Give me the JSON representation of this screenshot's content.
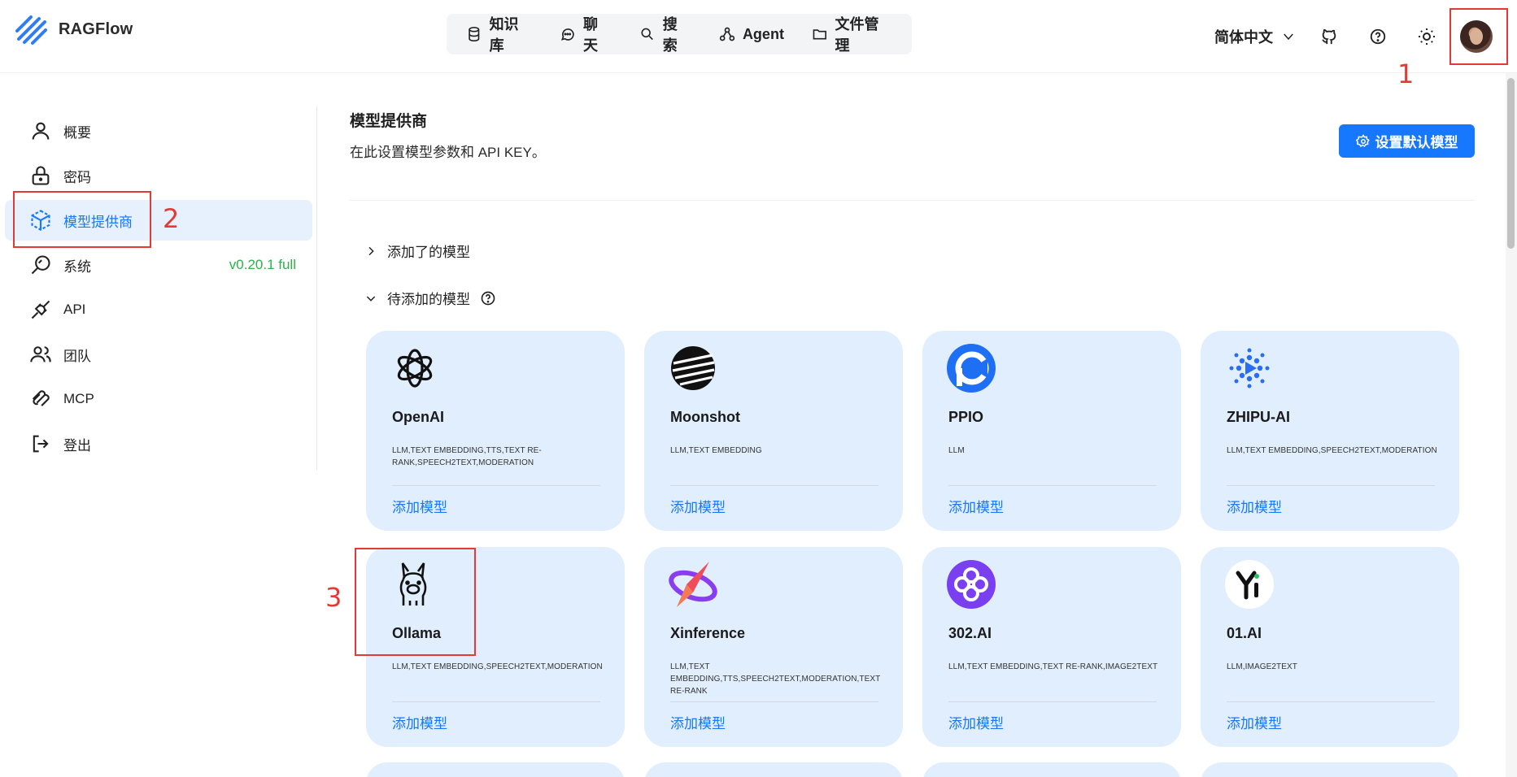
{
  "app": {
    "name": "RAGFlow"
  },
  "nav": [
    {
      "label": "知识库",
      "icon": "database-icon"
    },
    {
      "label": "聊天",
      "icon": "chat-icon"
    },
    {
      "label": "搜索",
      "icon": "search-icon"
    },
    {
      "label": "Agent",
      "icon": "agent-icon"
    },
    {
      "label": "文件管理",
      "icon": "folder-icon"
    }
  ],
  "header": {
    "language": "简体中文"
  },
  "sidebar": {
    "items": [
      {
        "label": "概要",
        "icon": "user-icon"
      },
      {
        "label": "密码",
        "icon": "lock-icon"
      },
      {
        "label": "模型提供商",
        "icon": "model-cube-icon",
        "active": true
      },
      {
        "label": "系统",
        "icon": "gauge-icon"
      },
      {
        "label": "API",
        "icon": "plug-icon"
      },
      {
        "label": "团队",
        "icon": "team-icon"
      },
      {
        "label": "MCP",
        "icon": "mcp-icon"
      },
      {
        "label": "登出",
        "icon": "logout-icon"
      }
    ],
    "version": "v0.20.1 full"
  },
  "main": {
    "title": "模型提供商",
    "subtitle": "在此设置模型参数和 API KEY。",
    "set_default_label": "设置默认模型",
    "added_section": "添加了的模型",
    "pending_section": "待添加的模型"
  },
  "providers": [
    {
      "name": "OpenAI",
      "tags": "LLM,TEXT EMBEDDING,TTS,TEXT RE-RANK,SPEECH2TEXT,MODERATION",
      "action": "添加模型",
      "icon": "openai-logo-icon"
    },
    {
      "name": "Moonshot",
      "tags": "LLM,TEXT EMBEDDING",
      "action": "添加模型",
      "icon": "moonshot-logo-icon"
    },
    {
      "name": "PPIO",
      "tags": "LLM",
      "action": "添加模型",
      "icon": "ppio-logo-icon"
    },
    {
      "name": "ZHIPU-AI",
      "tags": "LLM,TEXT EMBEDDING,SPEECH2TEXT,MODERATION",
      "action": "添加模型",
      "icon": "zhipu-logo-icon"
    },
    {
      "name": "Ollama",
      "tags": "LLM,TEXT EMBEDDING,SPEECH2TEXT,MODERATION",
      "action": "添加模型",
      "icon": "ollama-logo-icon"
    },
    {
      "name": "Xinference",
      "tags": "LLM,TEXT EMBEDDING,TTS,SPEECH2TEXT,MODERATION,TEXT RE-RANK",
      "action": "添加模型",
      "icon": "xinference-logo-icon"
    },
    {
      "name": "302.AI",
      "tags": "LLM,TEXT EMBEDDING,TEXT RE-RANK,IMAGE2TEXT",
      "action": "添加模型",
      "icon": "302ai-logo-icon"
    },
    {
      "name": "01.AI",
      "tags": "LLM,IMAGE2TEXT",
      "action": "添加模型",
      "icon": "01ai-logo-icon"
    }
  ],
  "annotations": [
    "1",
    "2",
    "3"
  ],
  "colors": {
    "accent": "#1677ff",
    "card_bg": "#e1eefd",
    "annotation": "#e53935",
    "version": "#2ab34a"
  }
}
